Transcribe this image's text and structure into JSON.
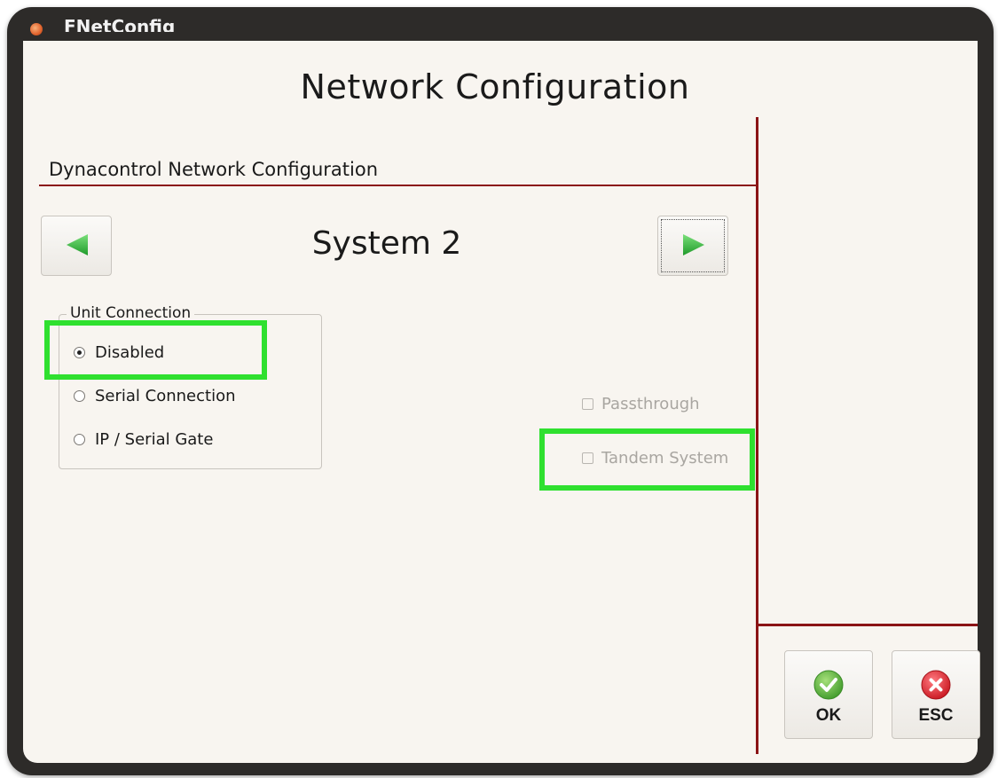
{
  "window": {
    "title": "FNetConfig"
  },
  "page": {
    "title": "Network Configuration",
    "section_title": "Dynacontrol Network Configuration",
    "system_label": "System 2"
  },
  "unit_connection": {
    "legend": "Unit Connection",
    "options": [
      {
        "label": "Disabled",
        "selected": true
      },
      {
        "label": "Serial Connection",
        "selected": false
      },
      {
        "label": "IP / Serial Gate",
        "selected": false
      }
    ]
  },
  "options": {
    "passthrough": {
      "label": "Passthrough",
      "checked": false,
      "enabled": false
    },
    "tandem": {
      "label": "Tandem System",
      "checked": false,
      "enabled": false
    }
  },
  "buttons": {
    "ok_label": "OK",
    "esc_label": "ESC",
    "prev_icon": "arrow-left-icon",
    "next_icon": "arrow-right-icon"
  },
  "colors": {
    "accent_line": "#8b1416",
    "highlight": "#2fe02f",
    "arrow_green": "#3cbf3c",
    "ok_green": "#5cb838",
    "esc_red": "#e0303a"
  }
}
